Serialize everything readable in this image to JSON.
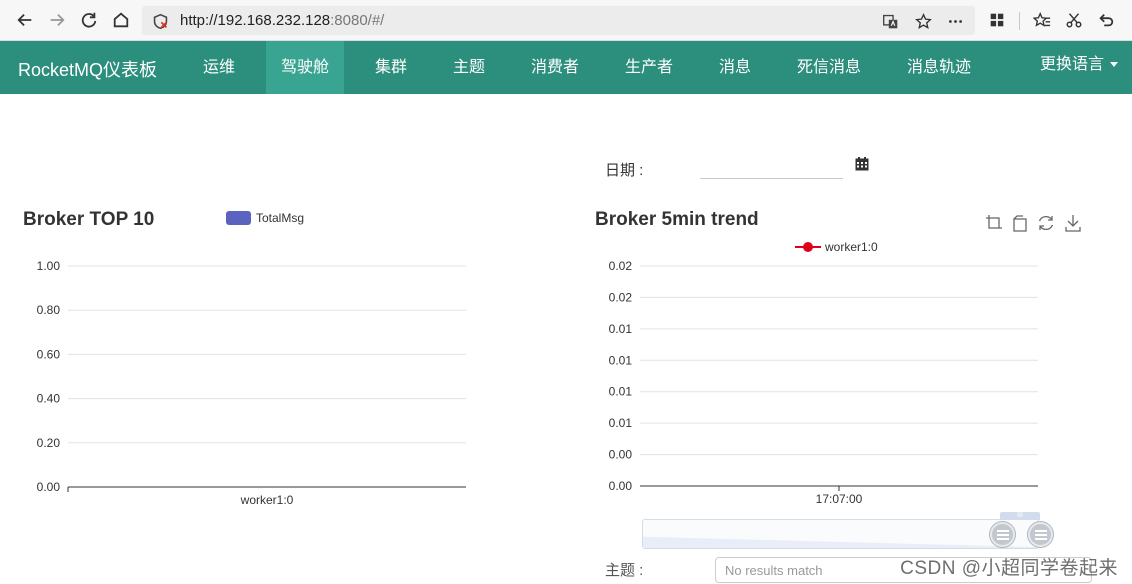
{
  "browser": {
    "url_host": "http://192.168.232.128",
    "url_rest": ":8080/#/"
  },
  "app_nav": {
    "brand": "RocketMQ仪表板",
    "items": [
      {
        "label": "运维",
        "active": false
      },
      {
        "label": "驾驶舱",
        "active": true
      },
      {
        "label": "集群",
        "active": false
      },
      {
        "label": "主题",
        "active": false
      },
      {
        "label": "消费者",
        "active": false
      },
      {
        "label": "生产者",
        "active": false
      },
      {
        "label": "消息",
        "active": false
      },
      {
        "label": "死信消息",
        "active": false
      },
      {
        "label": "消息轨迹",
        "active": false
      }
    ],
    "language_menu": "更换语言",
    "colors": {
      "bar": "#2c8e7c",
      "active": "#3aa493"
    }
  },
  "dashboard": {
    "date_label": "日期 :",
    "date_value": "",
    "topic_label": "主题 :",
    "topic_placeholder": "No results match"
  },
  "watermark": "CSDN @小超同学卷起来",
  "chart_data": [
    {
      "type": "bar",
      "title": "Broker TOP 10",
      "categories": [
        "worker1:0"
      ],
      "series": [
        {
          "name": "TotalMsg",
          "values": [
            0
          ]
        }
      ],
      "ylim": [
        0,
        1
      ],
      "yticks": [
        "1.00",
        "0.80",
        "0.60",
        "0.40",
        "0.20",
        "0.00"
      ],
      "grid": true,
      "legend": "top-center",
      "color": "#5b63c1"
    },
    {
      "type": "line",
      "title": "Broker 5min trend",
      "x": [
        "17:07:00"
      ],
      "series": [
        {
          "name": "worker1:0",
          "values": [
            0
          ]
        }
      ],
      "yticks": [
        "0.02",
        "0.02",
        "0.01",
        "0.01",
        "0.01",
        "0.01",
        "0.00",
        "0.00"
      ],
      "grid": true,
      "legend": "top-center",
      "color": "#e0001b",
      "toolbox": [
        "zoom-icon",
        "zoom-reset-icon",
        "restore-icon",
        "download-icon"
      ]
    }
  ]
}
